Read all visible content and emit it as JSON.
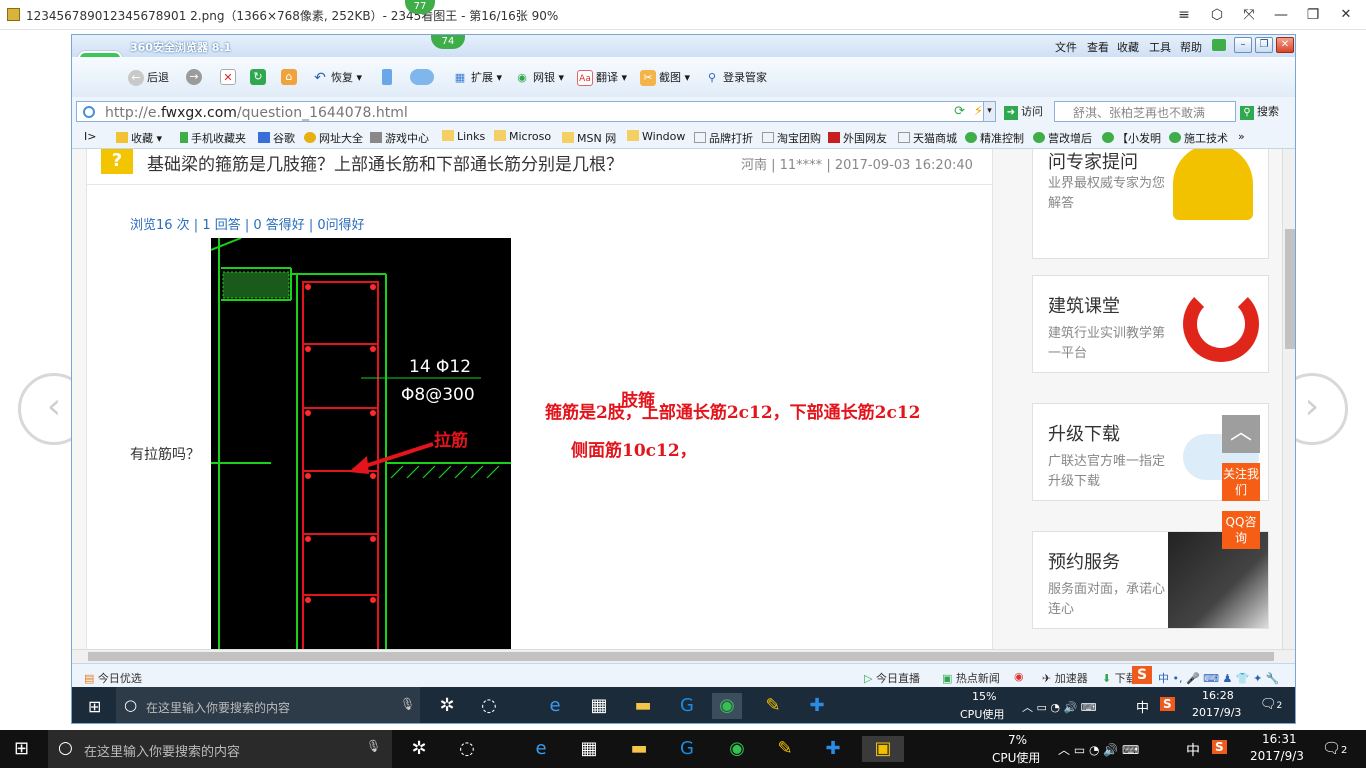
{
  "viewer": {
    "title": "123456789012345678901 2.png（1366×768像素, 252KB）- 2345看图王 - 第16/16张 90%",
    "title_text": "123456789012345678901 2.png（1366×768像素, 252KB）- 2345看图王 - 第16/16张 90%",
    "badge_top": "77",
    "buttons": [
      "≡",
      "⬡",
      "⤧",
      "—",
      "❐",
      "✕"
    ]
  },
  "browser": {
    "name": "360安全浏览器 8.1",
    "badge": "74",
    "menu": [
      "文件",
      "查看",
      "收藏",
      "工具",
      "帮助"
    ],
    "toolbar": {
      "back": "后退",
      "restore": "恢复",
      "extend": "扩展",
      "netbank": "网银",
      "translate": "翻译",
      "screenshot": "截图",
      "login": "登录管家"
    },
    "address": {
      "prefix": "http://e.",
      "domain": "fwxgx.com",
      "path": "/question_1644078.html",
      "visit": "访问",
      "search_placeholder": "舒淇、张柏芝再也不敢满",
      "search_button": "搜索"
    },
    "favorites": [
      "收藏",
      "手机收藏夹",
      "谷歌",
      "网址大全",
      "游戏中心",
      "Links",
      "Microso",
      "MSN 网",
      "Window",
      "品牌打折",
      "淘宝团购",
      "外国网友",
      "天猫商城",
      "精准控制",
      "营改增后",
      "【小发明",
      "施工技术"
    ],
    "status": {
      "left": "今日优选",
      "live": "今日直播",
      "hotnews": "热点新闻",
      "accelerator": "加速器",
      "download": "下载"
    }
  },
  "article": {
    "badge": "?",
    "title": "基础梁的箍筋是几肢箍？上部通长筋和下部通长筋分别是几根？",
    "meta": "河南 | 11**** | 2017-09-03 16:20:40",
    "stats": "浏览16 次 | 1 回答 | 0 答得好 | 0问得好",
    "question": "有拉筋吗？",
    "cad": {
      "label1": "14 Φ12",
      "label2": "Φ8@300",
      "tie_label": "拉筋"
    },
    "annotation_top": "肢箍",
    "annotation_line1": "箍筋是2肢，上部通长筋2c12，下部通长筋2c12",
    "annotation_line2": "侧面筋10c12，"
  },
  "sidebar": [
    {
      "title": "问专家提问",
      "desc": "业界最权威专家为您解答"
    },
    {
      "title": "建筑课堂",
      "desc": "建筑行业实训教学第一平台"
    },
    {
      "title": "升级下载",
      "desc": "广联达官方唯一指定升级下载"
    },
    {
      "title": "预约服务",
      "desc": "服务面对面，承诺心连心"
    }
  ],
  "float_buttons": {
    "top": "︿",
    "follow": "关注我们",
    "qq": "QQ咨询"
  },
  "inner_taskbar": {
    "search": "在这里输入你要搜索的内容",
    "cpu": "15%",
    "cpu_label": "CPU使用",
    "ime": "中",
    "time": "16:28",
    "date": "2017/9/3",
    "notif": "2"
  },
  "outer_taskbar": {
    "search": "在这里输入你要搜索的内容",
    "cpu": "7%",
    "cpu_label": "CPU使用",
    "ime": "中",
    "time": "16:31",
    "date": "2017/9/3",
    "notif": "2"
  },
  "colors": {
    "accent_red": "#e3141b",
    "browser_green": "#1d9a38",
    "float_orange": "#f55e14",
    "link_blue": "#2a6ebb"
  }
}
